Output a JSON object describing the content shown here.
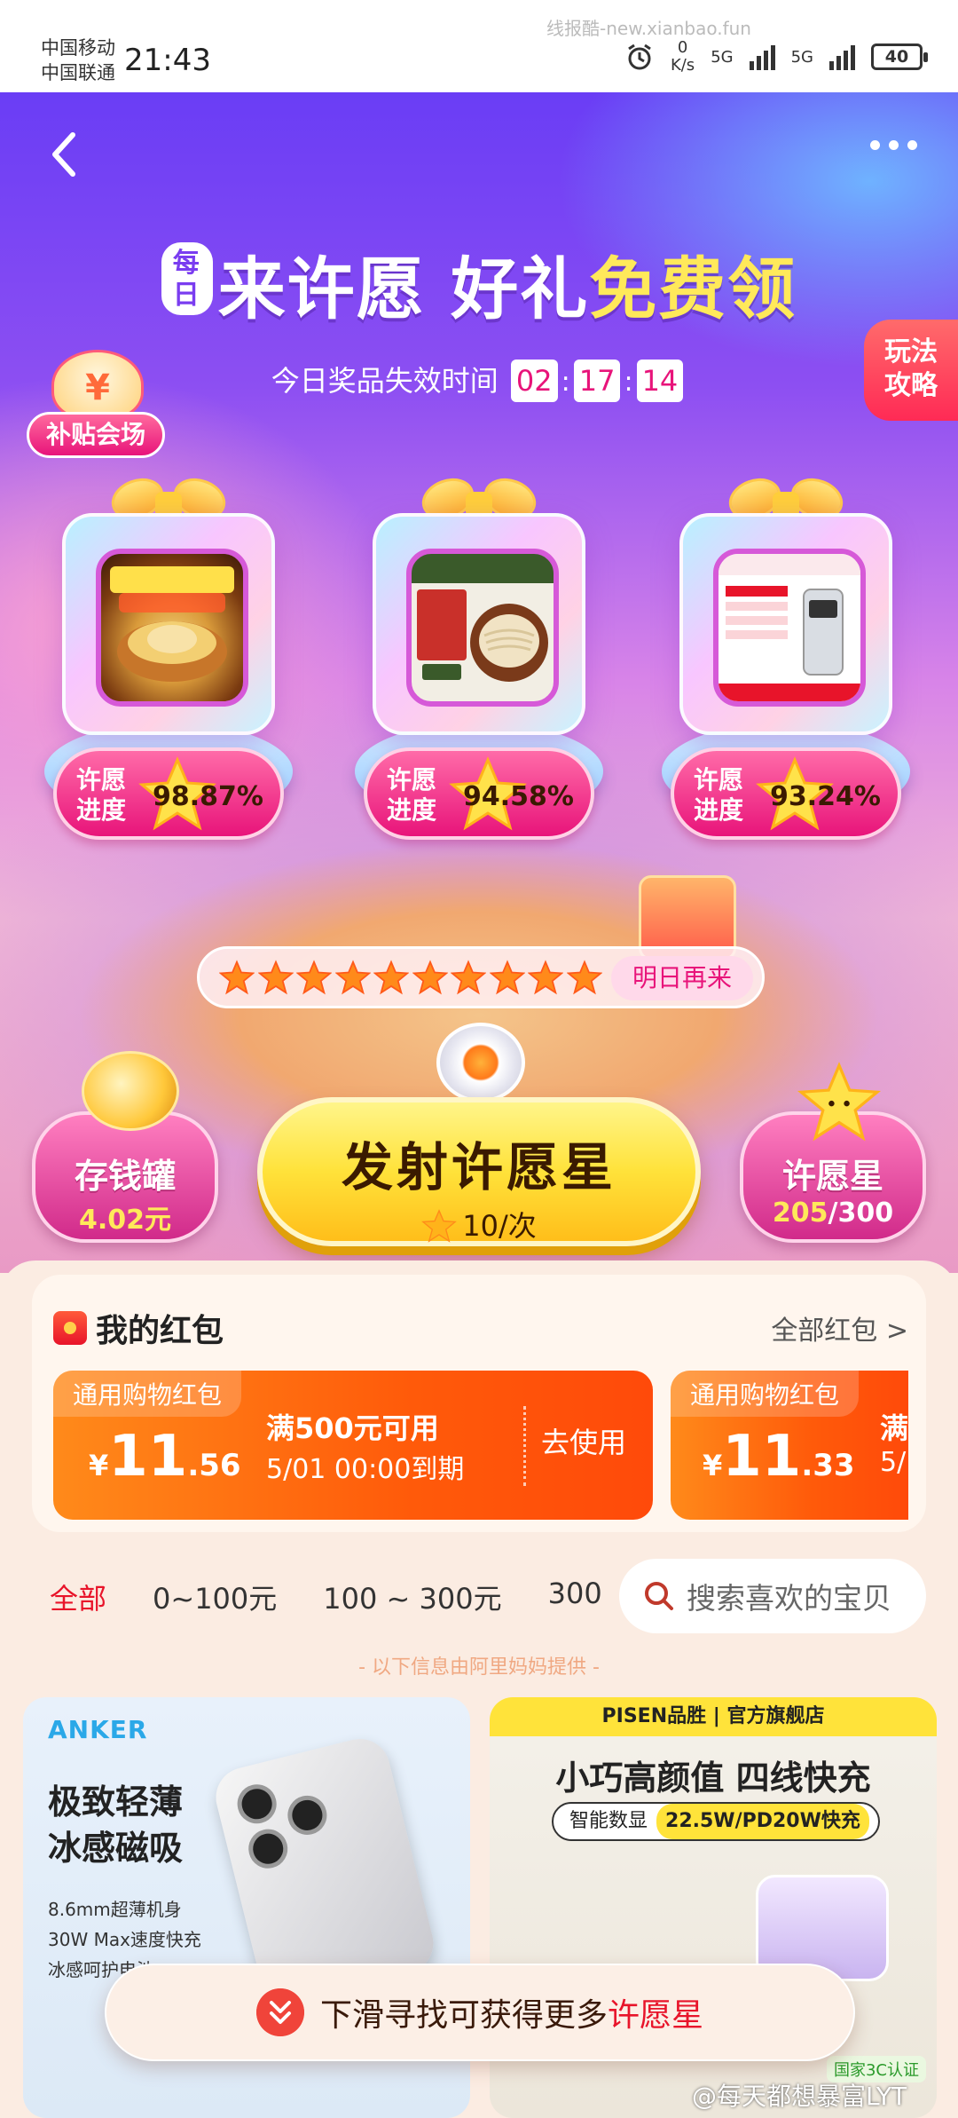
{
  "status_bar": {
    "carrier_1": "中国移动",
    "carrier_2": "中国联通",
    "time": "21:43",
    "watermark": "线报酷-new.xianbao.fun",
    "net_speed": "0",
    "net_unit": "K/s",
    "sig_1": "5G",
    "sig_2": "5G",
    "battery": "40"
  },
  "hero": {
    "daily_badge": "每日",
    "title_white": "来许愿 好礼",
    "title_yellow": "免费领",
    "countdown_label": "今日奖品失效时间",
    "countdown": {
      "h": "02",
      "m": "17",
      "s": "14"
    },
    "rules_button": "玩法攻略",
    "subsidy_label": "补贴会场",
    "gifts": [
      {
        "progress_label": "许愿进度",
        "progress": "98.87%",
        "image": "chicken-soup"
      },
      {
        "progress_label": "许愿进度",
        "progress": "94.58%",
        "image": "noodles"
      },
      {
        "progress_label": "许愿进度",
        "progress": "93.24%",
        "image": "power-bank"
      }
    ],
    "stars_filled": 10,
    "tomorrow_label": "明日再来",
    "piggy_bank": {
      "label": "存钱罐",
      "value": "4.02元"
    },
    "launch_button": {
      "label": "发射许愿星",
      "cost": "10/次"
    },
    "wish_star": {
      "label": "许愿星",
      "current": "205",
      "total": "/300"
    }
  },
  "red_packets": {
    "title": "我的红包",
    "view_all": "全部红包 >",
    "coupons": [
      {
        "tag": "通用购物红包",
        "currency": "¥",
        "amount_int": "11",
        "amount_dec": ".56",
        "condition": "满500元可用",
        "expiry": "5/01 00:00到期",
        "action": "去使用"
      },
      {
        "tag": "通用购物红包",
        "currency": "¥",
        "amount_int": "11",
        "amount_dec": ".33",
        "condition": "满",
        "expiry": "5/"
      }
    ]
  },
  "filter_tabs": [
    "全部",
    "0~100元",
    "100 ~ 300元",
    "300"
  ],
  "search": {
    "placeholder": "搜索喜欢的宝贝"
  },
  "provided_note": "- 以下信息由阿里妈妈提供 -",
  "products": {
    "anker": {
      "brand": "ANKER",
      "headline_1": "极致轻薄",
      "headline_2": "冰感磁吸",
      "feature_1": "8.6mm超薄机身",
      "feature_2": "30W Max速度快充",
      "feature_3": "冰感呵护电池"
    },
    "pisen": {
      "brand_bar": "PISEN品胜 | 官方旗舰店",
      "headline": "小巧高颜值 四线快充",
      "pill_left": "智能数显",
      "pill_right": "22.5W/PD20W快充",
      "cert": "国家3C认证"
    }
  },
  "toast": {
    "prefix": "下滑寻找可获得更多",
    "highlight": "许愿星"
  },
  "bottom_watermark": "@每天都想暴富LYT"
}
